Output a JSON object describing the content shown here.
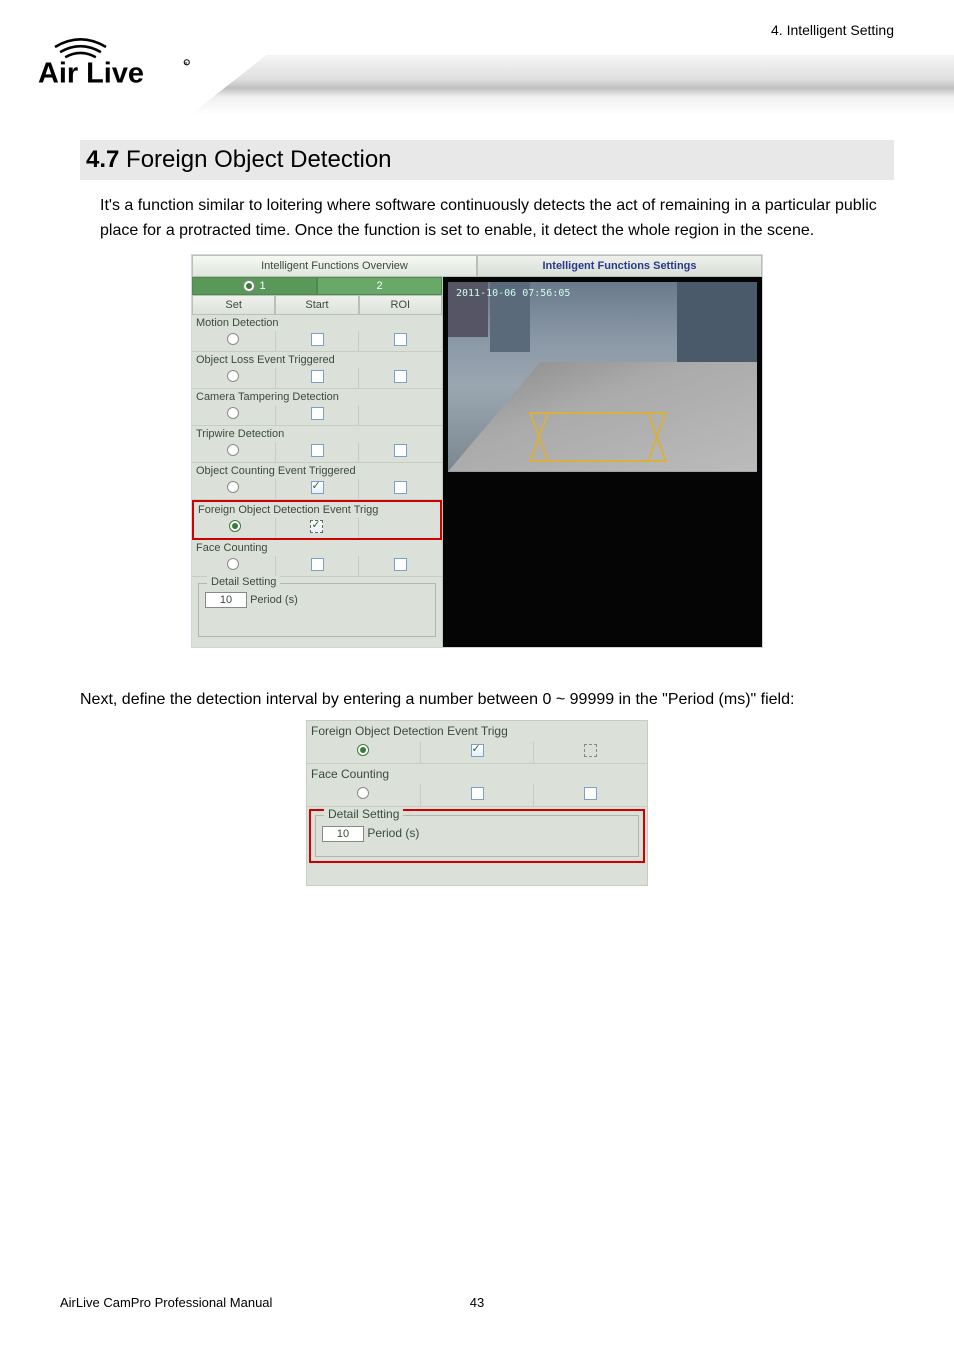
{
  "header": {
    "chapter_label": "4.  Intelligent  Setting",
    "logo_text": "Air Live"
  },
  "section": {
    "number": "4.7",
    "title": "Foreign Object Detection"
  },
  "paragraph1": "It's a function similar to loitering where software continuously detects the act of remaining in a particular public place for a protracted time. Once the function is set to enable, it detect the whole region in the scene.",
  "paragraph2": "Next, define the detection interval by entering a number between 0 ~ 99999 in the \"Period (ms)\" field:",
  "screenshot1": {
    "tab_overview": "Intelligent Functions Overview",
    "tab_settings": "Intelligent Functions Settings",
    "channel1": "1",
    "channel2": "2",
    "col_set": "Set",
    "col_start": "Start",
    "col_roi": "ROI",
    "rows": {
      "motion": "Motion Detection",
      "objloss": "Object Loss Event Triggered",
      "tamper": "Camera Tampering Detection",
      "tripwire": "Tripwire Detection",
      "objcount": "Object Counting Event Triggered",
      "foreign": "Foreign Object Detection Event Trigg",
      "face": "Face Counting"
    },
    "detail_legend": "Detail Setting",
    "period_value": "10",
    "period_label": "Period (s)",
    "timestamp": "2011-10-06 07:56:05"
  },
  "screenshot2": {
    "foreign": "Foreign Object Detection Event Trigg",
    "face": "Face Counting",
    "detail_legend": "Detail Setting",
    "period_value": "10",
    "period_label": "Period (s)"
  },
  "footer": {
    "manual": "AirLive  CamPro  Professional  Manual",
    "page": "43"
  }
}
